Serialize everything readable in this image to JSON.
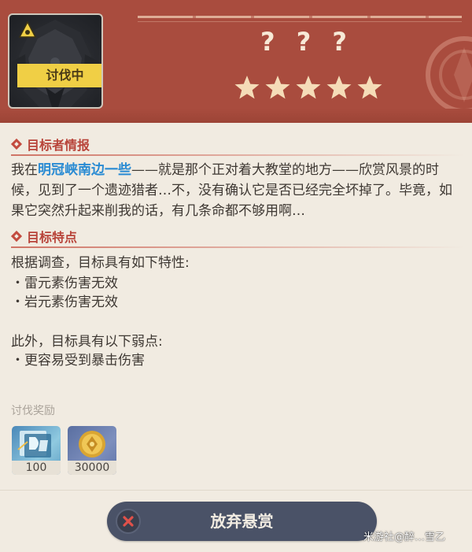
{
  "header": {
    "status_label": "讨伐中",
    "boss_name": "? ? ?",
    "star_count": 5,
    "star_max": 5,
    "colors": {
      "header_bg": "#a94c3e",
      "status_bg": "#f0cf45",
      "star": "#f5dcb8"
    }
  },
  "target_info": {
    "title": "目标者情报",
    "text_before": "我在",
    "highlight": "明冠峡南边一些",
    "text_after": "——就是那个正对着大教堂的地方——欣赏风景的时候，见到了一个遗迹猎者…不，没有确认它是否已经完全坏掉了。毕竟，如果它突然升起来削我的话，有几条命都不够用啊…",
    "highlight_color": "#2a8bd3"
  },
  "target_traits": {
    "title": "目标特点",
    "intro": "根据调查，目标具有如下特性:",
    "traits": [
      "・雷元素伤害无效",
      "・岩元素伤害无效"
    ],
    "weakness_intro": "此外，目标具有以下弱点:",
    "weaknesses": [
      "・更容易受到暴击伤害"
    ]
  },
  "rewards": {
    "title": "讨伐奖励",
    "items": [
      {
        "icon": "adventure-exp-icon",
        "count": "100"
      },
      {
        "icon": "mora-coin-icon",
        "count": "30000"
      }
    ]
  },
  "actions": {
    "abandon_label": "放弃悬赏",
    "abandon_icon": "close-icon"
  },
  "watermark": "米游社@醉…雪乙"
}
